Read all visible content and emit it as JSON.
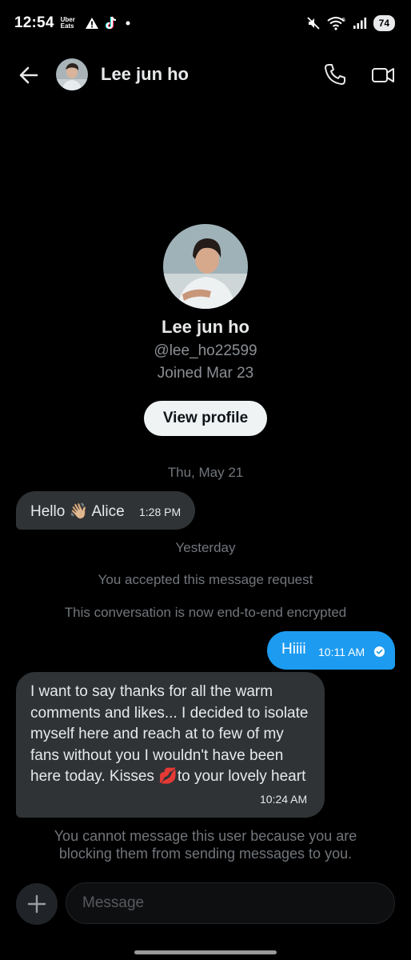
{
  "status_bar": {
    "time": "12:54",
    "uber_eats": "Uber\nEats",
    "battery": "74"
  },
  "header": {
    "name": "Lee jun ho"
  },
  "profile": {
    "name": "Lee jun ho",
    "handle": "@lee_ho22599",
    "joined": "Joined Mar 23",
    "view_profile_label": "View profile"
  },
  "conversation": {
    "date_1": "Thu, May 21",
    "message_1": {
      "text": "Hello 👋🏼 Alice",
      "time": "1:28 PM"
    },
    "date_2": "Yesterday",
    "system_accepted": "You accepted this message request",
    "system_encrypted": "This conversation is now end-to-end encrypted",
    "message_2": {
      "text": "Hiiii",
      "time": "10:11 AM"
    },
    "message_3": {
      "text": "I want to say thanks for all the warm comments and likes... I decided to isolate myself here and reach at to few of my fans without you I wouldn't have been here  today. Kisses 💋to your lovely heart",
      "time": "10:24 AM"
    },
    "blocked_notice": "You cannot message this user because you are blocking them from sending messages to you."
  },
  "composer": {
    "placeholder": "Message"
  },
  "colors": {
    "background": "#000000",
    "incoming_bubble": "#2f3336",
    "outgoing_bubble": "#1d9bf0",
    "muted_text": "#71767b"
  }
}
